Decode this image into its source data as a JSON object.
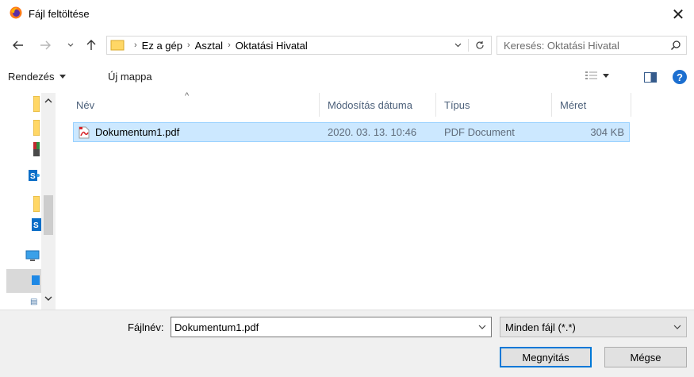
{
  "window": {
    "title": "Fájl feltöltése",
    "close_glyph": "✕"
  },
  "address": {
    "breadcrumbs": [
      "Ez a gép",
      "Asztal",
      "Oktatási Hivatal"
    ],
    "search_placeholder": "Keresés: Oktatási Hivatal"
  },
  "toolbar": {
    "organize": "Rendezés",
    "new_folder": "Új mappa"
  },
  "columns": {
    "name": "Név",
    "modified": "Módosítás dátuma",
    "type": "Típus",
    "size": "Méret"
  },
  "files": [
    {
      "name": "Dokumentum1.pdf",
      "modified": "2020. 03. 13. 10:46",
      "type": "PDF Document",
      "size": "304 KB"
    }
  ],
  "bottom": {
    "filename_label": "Fájlnév:",
    "filename_value": "Dokumentum1.pdf",
    "filetype": "Minden fájl (*.*)",
    "open_button": "Megnyitás",
    "cancel_button": "Mégse"
  },
  "colors": {
    "accent": "#0078d7",
    "selection": "#cce8ff",
    "folder": "#ffd766"
  }
}
